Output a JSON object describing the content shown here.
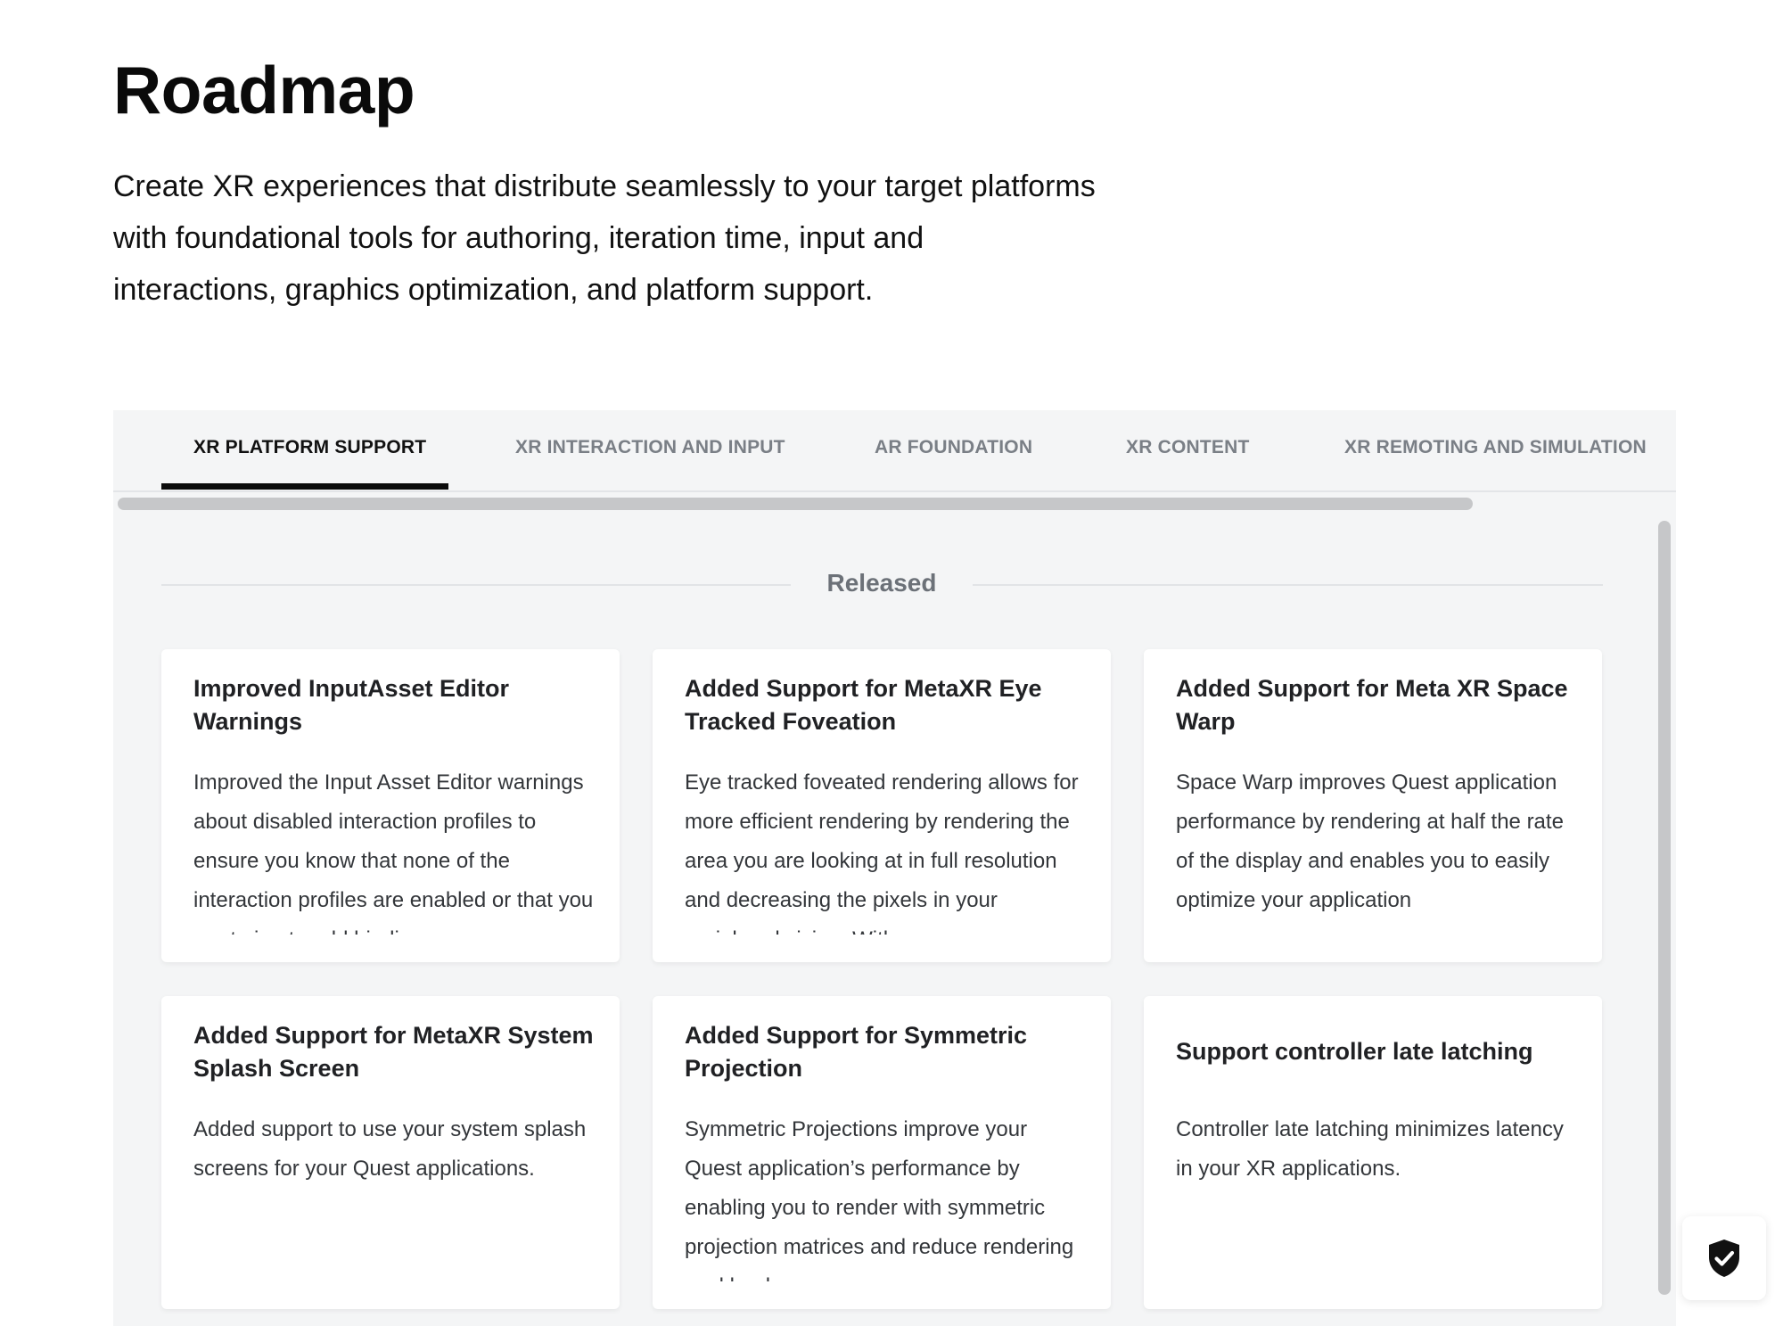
{
  "header": {
    "title": "Roadmap",
    "intro_lines": [
      "Create XR experiences that distribute seamlessly to your target platforms",
      "with foundational tools for authoring, iteration time, input and",
      "interactions, graphics optimization, and platform support."
    ]
  },
  "tabs": [
    {
      "label": "XR PLATFORM SUPPORT",
      "active": true
    },
    {
      "label": "XR INTERACTION AND INPUT",
      "active": false
    },
    {
      "label": "AR FOUNDATION",
      "active": false
    },
    {
      "label": "XR CONTENT",
      "active": false
    },
    {
      "label": "XR REMOTING AND SIMULATION",
      "active": false
    }
  ],
  "section": {
    "label": "Released"
  },
  "cards": [
    {
      "title": "Improved InputAsset Editor Warnings",
      "body": "Improved the Input Asset Editor warnings about disabled interaction profiles to ensure you know that none of the interaction profiles are enabled or that you are trying to add bindings"
    },
    {
      "title": "Added Support for MetaXR Eye Tracked Foveation",
      "body": "Eye tracked foveated rendering allows for more efficient rendering by rendering the area you are looking at in full resolution and decreasing the pixels in your peripheral vision. With"
    },
    {
      "title": "Added Support for Meta XR Space Warp",
      "body": "Space Warp improves Quest application performance by rendering at half the rate of the display and enables you to easily optimize your application"
    },
    {
      "title": "Added Support for MetaXR System Splash Screen",
      "body": "Added support to use your system splash screens for your Quest applications."
    },
    {
      "title": "Added Support for Symmetric Projection",
      "body": "Symmetric Projections improve your Quest application’s performance by enabling you to render with symmetric projection matrices and reduce rendering workloads."
    },
    {
      "title": "Support controller late latching",
      "body": "Controller late latching minimizes latency in your  XR applications."
    }
  ],
  "icons": {
    "security_badge": "shield-check-icon"
  }
}
